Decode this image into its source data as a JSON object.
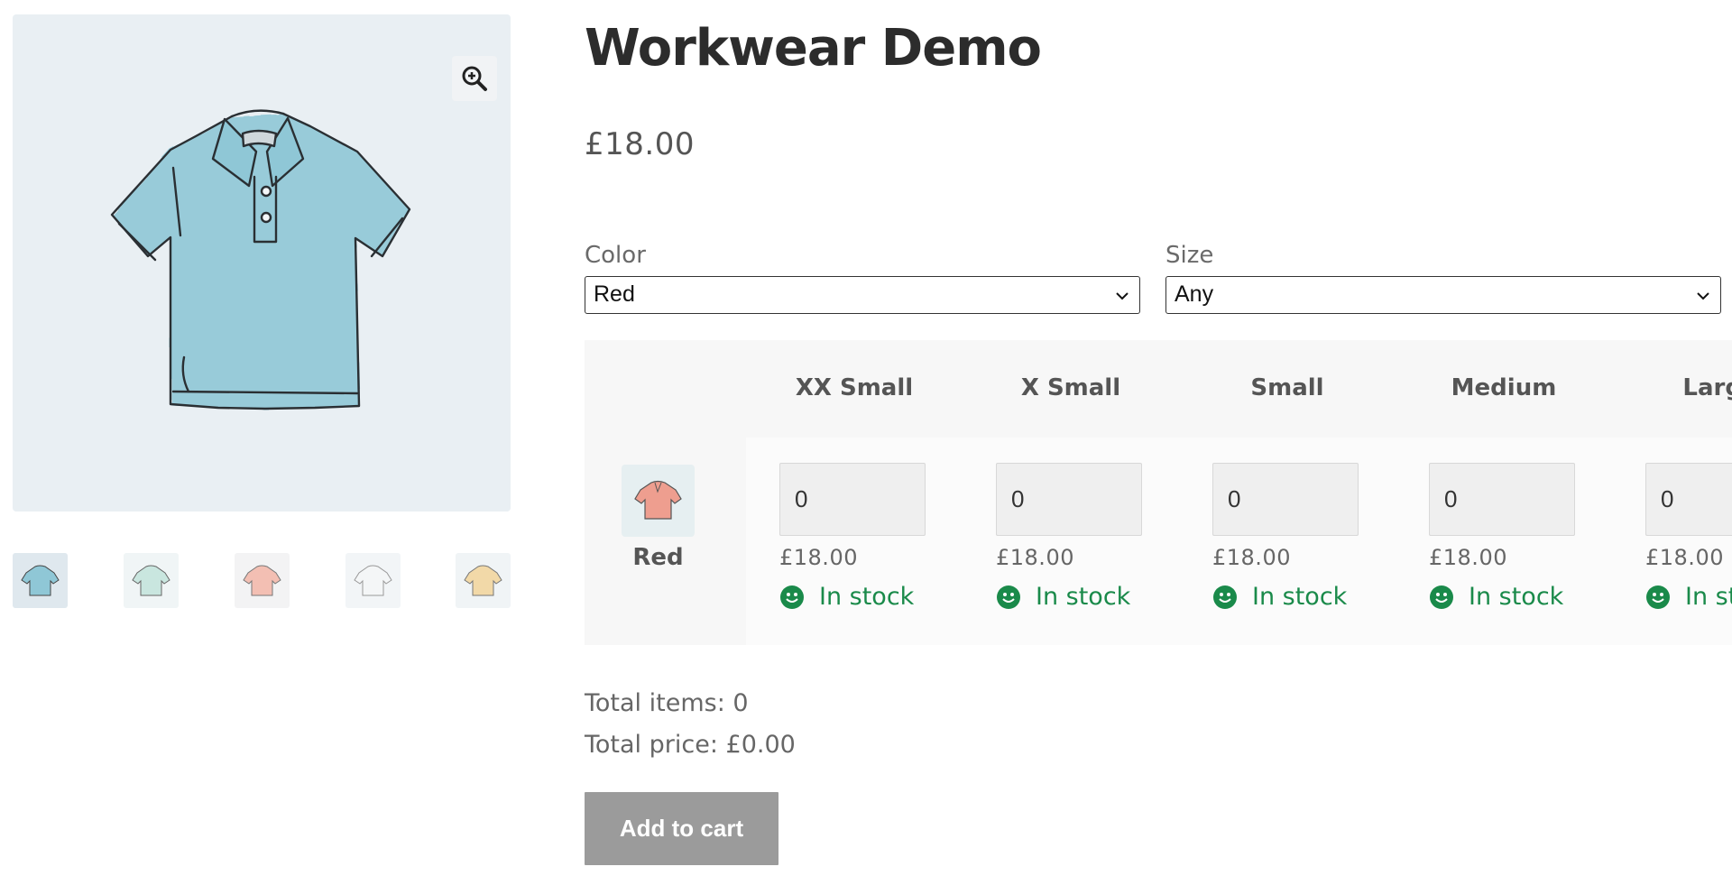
{
  "product": {
    "title": "Workwear Demo",
    "price": "£18.00"
  },
  "gallery": {
    "main_color": "#8fc7d6",
    "zoom_icon": "zoom-in-icon",
    "thumbnails": [
      {
        "name": "blue",
        "color": "#8fc7d6",
        "selected": true
      },
      {
        "name": "mint",
        "color": "#c9e6df",
        "selected": false
      },
      {
        "name": "pink",
        "color": "#f3bfb3",
        "selected": false
      },
      {
        "name": "white",
        "color": "#f4f6f7",
        "selected": false
      },
      {
        "name": "yellow",
        "color": "#f2d9a8",
        "selected": false
      }
    ]
  },
  "filters": {
    "color_label": "Color",
    "color_value": "Red",
    "size_label": "Size",
    "size_value": "Any"
  },
  "grid": {
    "row": {
      "label": "Red",
      "swatch_color": "#ee9e8f"
    },
    "columns": [
      {
        "size": "XX Small",
        "qty": "0",
        "price": "£18.00",
        "stock": "In stock"
      },
      {
        "size": "X Small",
        "qty": "0",
        "price": "£18.00",
        "stock": "In stock"
      },
      {
        "size": "Small",
        "qty": "0",
        "price": "£18.00",
        "stock": "In stock"
      },
      {
        "size": "Medium",
        "qty": "0",
        "price": "£18.00",
        "stock": "In stock"
      },
      {
        "size": "Large",
        "qty": "0",
        "price": "£18.00",
        "stock": "In stock"
      }
    ]
  },
  "totals": {
    "items": "Total items: 0",
    "price": "Total price: £0.00"
  },
  "actions": {
    "add_to_cart": "Add to cart"
  },
  "colors": {
    "in_stock": "#1a8a4a",
    "button_bg": "#9b9b9b"
  }
}
